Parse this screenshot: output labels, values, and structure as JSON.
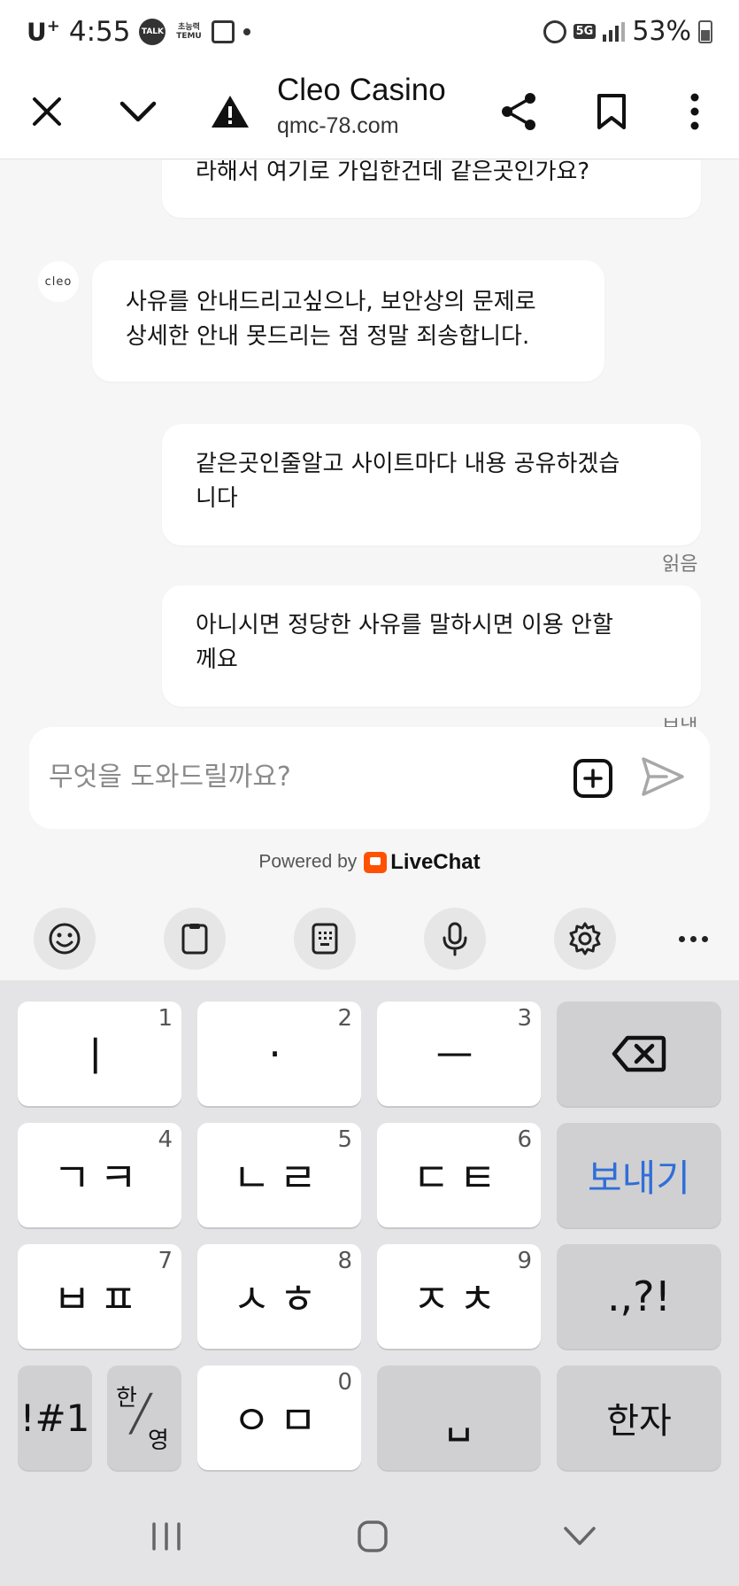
{
  "status_bar": {
    "carrier": "U",
    "carrier_sup": "+",
    "time": "4:55",
    "talk_badge": "TALK",
    "temu_badge_top": "초능력",
    "temu_badge_bottom": "TEMU",
    "network": "5G",
    "battery": "53%"
  },
  "toolbar": {
    "title": "Cleo Casino",
    "url": "qmc-78.com"
  },
  "chat": {
    "avatar_text": "cleo",
    "messages": [
      {
        "line1": "라해서 여기로 가입한건데 같은곳인가요?",
        "line2": ""
      },
      {
        "line1": "사유를 안내드리고싶으나, 보안상의 문제로",
        "line2": "상세한 안내 못드리는 점 정말 죄송합니다."
      },
      {
        "line1": "같은곳인줄알고 사이트마다 내용 공유하겠습",
        "line2": "니다"
      },
      {
        "line1": "아니시면 정당한 사유를 말하시면 이용 안할",
        "line2": "께요"
      }
    ],
    "read_label": "읽음",
    "sent_label": "보냄"
  },
  "composer": {
    "placeholder": "무엇을 도와드릴까요?",
    "value": ""
  },
  "powered_by": {
    "prefix": "Powered by",
    "brand": "LiveChat"
  },
  "keyboard": {
    "rows": [
      [
        {
          "main": "ㅣ",
          "num": "1"
        },
        {
          "main": "·",
          "num": "2"
        },
        {
          "main": "ㅡ",
          "num": "3"
        }
      ],
      [
        {
          "main": "ㄱㅋ",
          "num": "4"
        },
        {
          "main": "ㄴㄹ",
          "num": "5"
        },
        {
          "main": "ㄷㅌ",
          "num": "6"
        }
      ],
      [
        {
          "main": "ㅂㅍ",
          "num": "7"
        },
        {
          "main": "ㅅㅎ",
          "num": "8"
        },
        {
          "main": "ㅈㅊ",
          "num": "9"
        }
      ]
    ],
    "send_key": "보내기",
    "punct_key": ".,?!",
    "symbol_key": "!#1",
    "lang_key_top": "한",
    "lang_key_bottom": "영",
    "bottom_center": {
      "main": "ㅇㅁ",
      "num": "0"
    },
    "space_key": "␣",
    "hanja_key": "한자"
  },
  "colors": {
    "accent_send_key": "#2f6fd6",
    "livechat_brand": "#ff5100"
  }
}
